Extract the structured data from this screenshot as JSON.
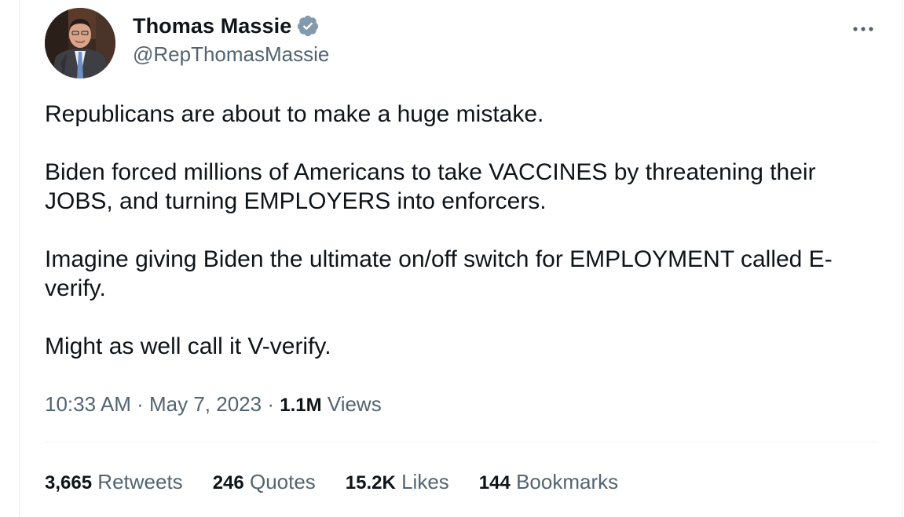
{
  "author": {
    "display_name": "Thomas Massie",
    "handle": "@RepThomasMassie",
    "verified": true,
    "verified_color": "#829aab"
  },
  "tweet": {
    "paragraphs": [
      "Republicans are about to make a huge mistake.",
      "Biden forced millions of Americans to take VACCINES by threatening their JOBS, and turning EMPLOYERS into enforcers.",
      "Imagine giving Biden the ultimate on/off switch for EMPLOYMENT called E-verify.",
      "Might as well call it V-verify."
    ],
    "time": "10:33 AM",
    "date": "May 7, 2023",
    "separator": "·",
    "views_count": "1.1M",
    "views_label": "Views"
  },
  "stats": {
    "retweets_count": "3,665",
    "retweets_label": "Retweets",
    "quotes_count": "246",
    "quotes_label": "Quotes",
    "likes_count": "15.2K",
    "likes_label": "Likes",
    "bookmarks_count": "144",
    "bookmarks_label": "Bookmarks"
  },
  "icons": {
    "more": "more-horizontal-icon",
    "verified": "verified-badge-icon"
  }
}
